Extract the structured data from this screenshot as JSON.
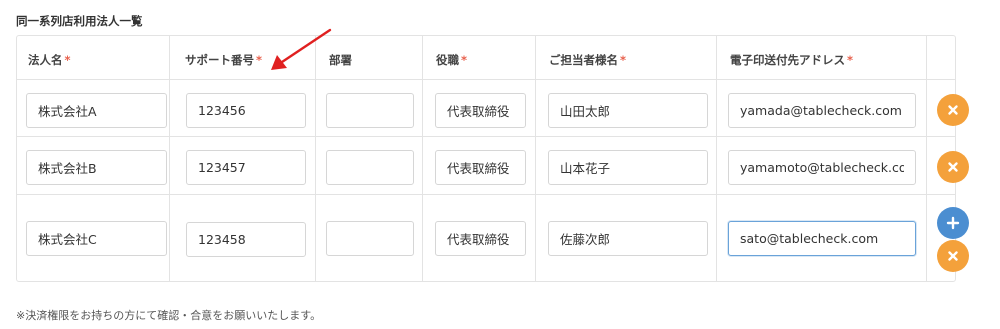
{
  "section_title": "同一系列店利用法人一覧",
  "required_mark": "*",
  "headers": [
    {
      "label": "法人名",
      "required": true
    },
    {
      "label": "サポート番号",
      "required": true
    },
    {
      "label": "部署",
      "required": false
    },
    {
      "label": "役職",
      "required": true
    },
    {
      "label": "ご担当者様名",
      "required": true
    },
    {
      "label": "電子印送付先アドレス",
      "required": true
    }
  ],
  "rows": [
    {
      "company": "株式会社A",
      "support_no": "123456",
      "department": "",
      "position": "代表取締役",
      "contact": "山田太郎",
      "email": "yamada@tablecheck.com"
    },
    {
      "company": "株式会社B",
      "support_no": "123457",
      "department": "",
      "position": "代表取締役",
      "contact": "山本花子",
      "email": "yamamoto@tablecheck.com"
    },
    {
      "company": "株式会社C",
      "support_no": "123458",
      "department": "",
      "position": "代表取締役",
      "contact": "佐藤次郎",
      "email": "sato@tablecheck.com"
    }
  ],
  "note": "※決済権限をお持ちの方にて確認・合意をお願いいたします。",
  "colors": {
    "required": "#e8604c",
    "remove_button": "#f4a13b",
    "add_button": "#4b8ed1",
    "arrow": "#e02020"
  }
}
